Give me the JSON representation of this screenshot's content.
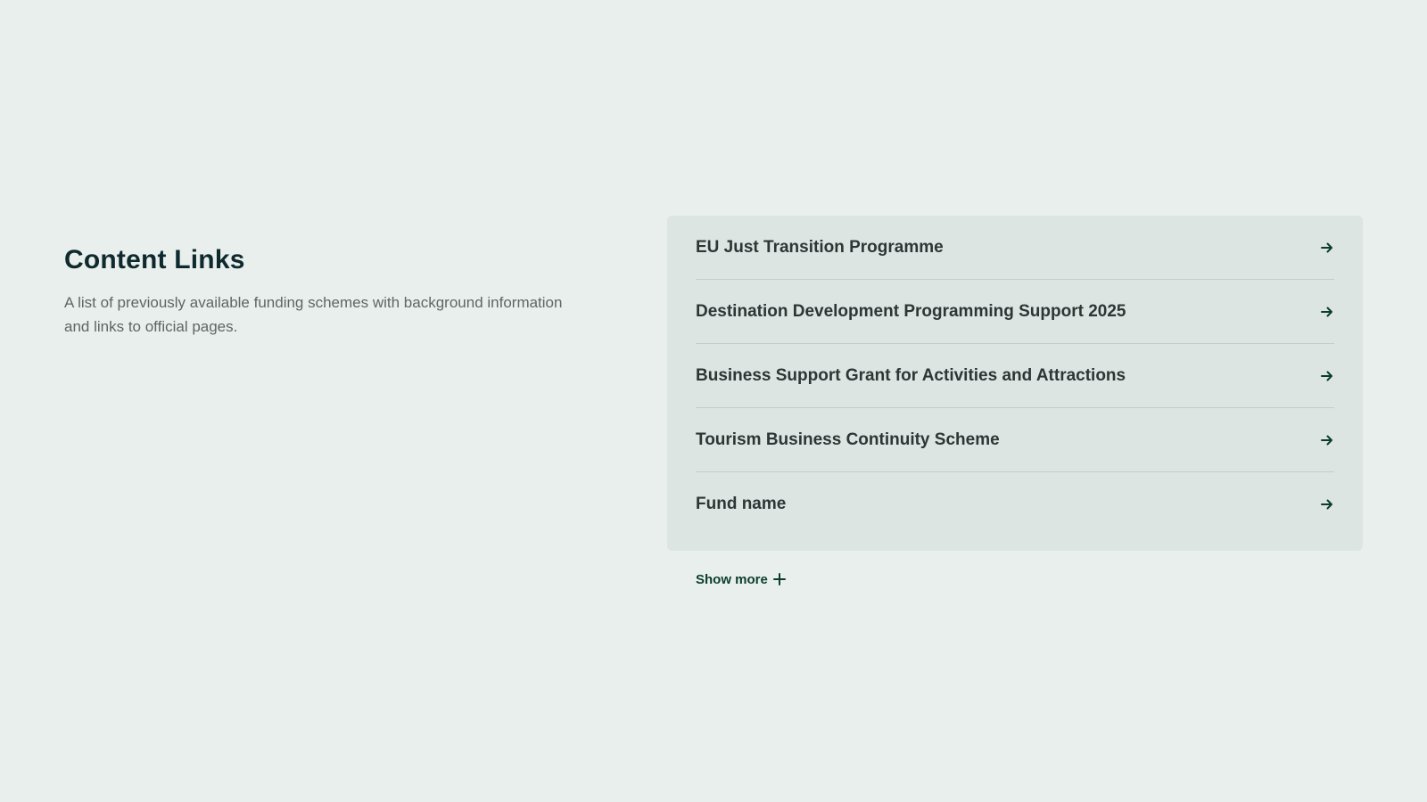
{
  "section": {
    "title": "Content Links",
    "description": "A list of previously available funding schemes with background information and links to official pages."
  },
  "links": [
    {
      "label": "EU Just Transition Programme",
      "icon": "arrow-right-icon"
    },
    {
      "label": "Destination Development Programming Support 2025",
      "icon": "arrow-right-icon"
    },
    {
      "label": "Business Support Grant for Activities and Attractions",
      "icon": "arrow-right-icon"
    },
    {
      "label": "Tourism Business Continuity Scheme",
      "icon": "arrow-right-icon"
    },
    {
      "label": "Fund name",
      "icon": "arrow-right-icon"
    }
  ],
  "show_more": {
    "label": "Show more",
    "icon": "plus-icon"
  },
  "colors": {
    "background": "#E9EFEC",
    "panel": "#DCE5E2",
    "accent": "#0B3D2E",
    "title": "#0E2A2E"
  }
}
